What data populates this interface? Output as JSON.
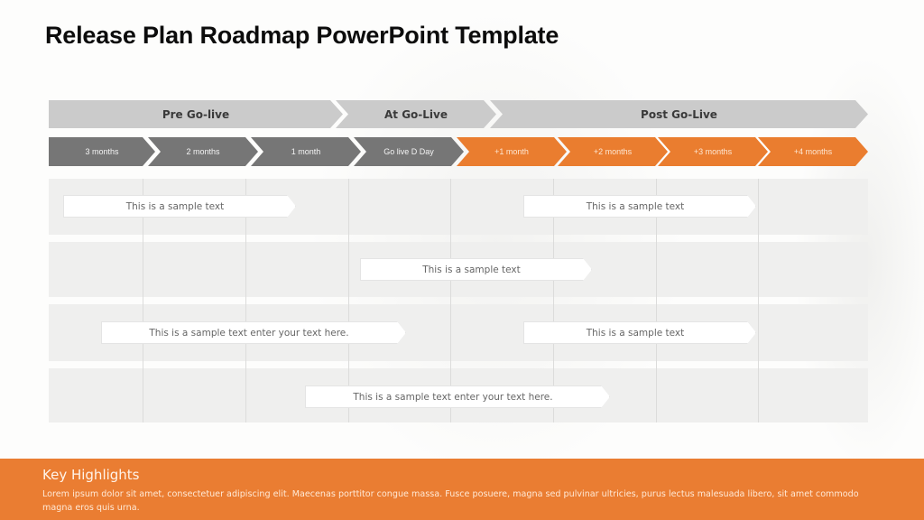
{
  "title": "Release Plan Roadmap PowerPoint Template",
  "phases": [
    {
      "label": "Pre Go-live"
    },
    {
      "label": "At Go-Live"
    },
    {
      "label": "Post Go-Live"
    }
  ],
  "timeline": [
    {
      "label": "3 months",
      "color": "#767676"
    },
    {
      "label": "2 months",
      "color": "#767676"
    },
    {
      "label": "1 month",
      "color": "#767676"
    },
    {
      "label": "Go live D Day",
      "color": "#767676"
    },
    {
      "label": "+1 month",
      "color": "#ea7d2f"
    },
    {
      "label": "+2 months",
      "color": "#ea7d2f"
    },
    {
      "label": "+3 months",
      "color": "#ea7d2f"
    },
    {
      "label": "+4 months",
      "color": "#ea7d2f"
    }
  ],
  "rows": [
    {
      "bars": [
        {
          "text": "This is a sample text"
        },
        {
          "text": "This is a sample text"
        }
      ]
    },
    {
      "bars": [
        {
          "text": "This is a sample text"
        }
      ]
    },
    {
      "bars": [
        {
          "text": "This is a sample text enter your text here."
        },
        {
          "text": "This is a sample text"
        }
      ]
    },
    {
      "bars": [
        {
          "text": "This is a sample text enter your text here."
        }
      ]
    }
  ],
  "footer": {
    "title": "Key Highlights",
    "body": "Lorem ipsum dolor sit amet, consectetuer adipiscing elit. Maecenas porttitor congue massa. Fusce posuere, magna sed pulvinar ultricies, purus lectus malesuada libero, sit amet commodo magna eros quis urna.",
    "color": "#ea7d32"
  }
}
